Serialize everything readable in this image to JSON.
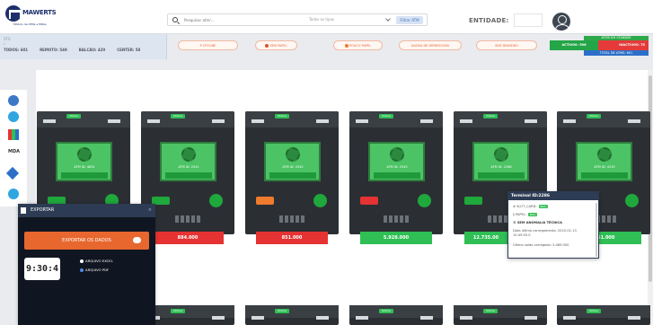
{
  "header": {
    "logo_text": "MAWERTS",
    "logo_subtitle": "Módulo de ATMs e MDAs",
    "search_placeholder": "Pesquisar atm/...",
    "filter_label": "Todos os tipos",
    "filter_button": "Filtrar ATM",
    "entity_label": "ENTIDADE:"
  },
  "left_panel": {
    "tag": "STS",
    "caret": "▾",
    "counters": [
      "TODOS: 601",
      "REMOTO: 549",
      "BALCÃO: 420",
      "CENTER: 58"
    ]
  },
  "actions": [
    {
      "label": "P OFFLINE",
      "dot": false
    },
    {
      "label": "SEM PAPEL",
      "dot": true
    },
    {
      "label": "POUCO PAPEL",
      "dot": true
    },
    {
      "label": "AVARIA DE IMPRESSORA",
      "dot": false
    },
    {
      "label": "SEM DINHEIRO",
      "dot": false
    }
  ],
  "status": {
    "top": "ATMS EM STANDBY",
    "active": "ACTIVOS: 596",
    "inactive": "INACTIVOS: 75",
    "total": "TOTAL DE ATMS: 601"
  },
  "sidebar": {
    "mda_label": "MDA"
  },
  "atms": [
    {
      "status": "Online",
      "id": "ATM ID: 4831",
      "value": "",
      "keypad": "#1fa83c"
    },
    {
      "status": "Online",
      "id": "ATM ID: 2541",
      "value": "884.000",
      "keypad": "#1fa83c",
      "value_color": "#e53333"
    },
    {
      "status": "Online",
      "id": "ATM ID: 2542",
      "value": "851.000",
      "keypad": "#f07a2e",
      "value_color": "#e53333"
    },
    {
      "status": "Online",
      "id": "ATM ID: 2543",
      "value": "5.928.000",
      "keypad": "#e53333",
      "value_color": "#2fbf55"
    },
    {
      "status": "Online",
      "id": "ATM ID: 2286",
      "value": "12.735.00",
      "keypad": "#1fa83c",
      "value_color": "#2fbf55"
    },
    {
      "status": "Online",
      "id": "ATM ID: 4319",
      "value": "151.000",
      "keypad": "#1fa83c",
      "value_color": "#2fbf55"
    }
  ],
  "bottom_atms": [
    "Online",
    "Online",
    "Online",
    "Online",
    "Online",
    "Online"
  ],
  "export": {
    "title": "EXPORTAR",
    "close": "×",
    "button": "EXPORTAR OS DADOS",
    "time": "9:30:4",
    "options": [
      "ARQUIVO EXCEL",
      "ARQUIVO PDF"
    ]
  },
  "tooltip": {
    "title": "Terminal ID:2286",
    "lines": [
      {
        "label": "# SLOT_CARD:",
        "badge": "Bom"
      },
      {
        "label": "§ PAPEL:",
        "badge": "Bom"
      },
      {
        "label": "© SEM ANOMALIA TÉCNICA",
        "strong": true
      },
      {
        "label": "Data última carregamento: 2022-01-13 15:49:55.0"
      },
      {
        "label": "Último saldo carregado: 3.489.000"
      }
    ]
  }
}
